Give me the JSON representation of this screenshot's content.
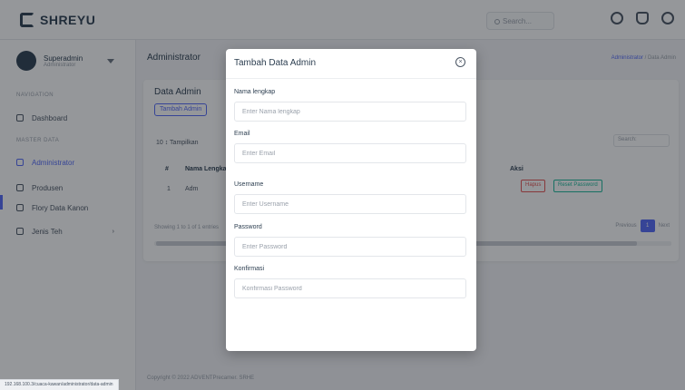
{
  "app": {
    "brand": "SHREYU"
  },
  "topbar": {
    "search_placeholder": "Search..."
  },
  "sidebar": {
    "user_name": "Superadmin",
    "user_role": "Administrator",
    "section_nav": "NAVIGATION",
    "section_data": "MASTER DATA",
    "items": [
      {
        "label": "Dashboard"
      },
      {
        "label": "Administrator"
      },
      {
        "label": "Produsen"
      },
      {
        "label": "Flory Data Kanon"
      },
      {
        "label": "Jenis Teh"
      }
    ]
  },
  "main": {
    "page_title": "Administrator",
    "breadcrumb_link": "Administrator",
    "breadcrumb_current": "Data Admin",
    "card_title": "Data Admin",
    "add_button": "Tambah Admin",
    "show_entries": "10  ↕  Tampilkan",
    "search_label": "Search:",
    "headers": [
      "#",
      "Nama Lengkap",
      "Aksi"
    ],
    "row": {
      "no": "1",
      "name": "Adm"
    },
    "delete_button": "Hapus",
    "reset_button": "Reset Password",
    "info": "Showing 1 to 1 of 1 entries",
    "prev": "Previous",
    "page": "1",
    "next": "Next",
    "footer": "Copyright © 2022 ADVENTPrecamer. SRHE"
  },
  "status_url": "192.168.100.3/cuaca-kawan/administrator/data-admin",
  "modal": {
    "title": "Tambah Data Admin",
    "close_glyph": "×",
    "fields": [
      {
        "label": "Nama lengkap",
        "placeholder": "Enter Nama lengkap"
      },
      {
        "label": "Email",
        "placeholder": "Enter Email"
      },
      {
        "label": "Username",
        "placeholder": "Enter Username"
      },
      {
        "label": "Password",
        "placeholder": "Enter Password"
      },
      {
        "label": "Konfirmasi",
        "placeholder": "Konfirmasi Password"
      }
    ]
  },
  "colors": {
    "accent": "#5369f8",
    "danger": "#e55353",
    "success": "#1bb99a"
  }
}
